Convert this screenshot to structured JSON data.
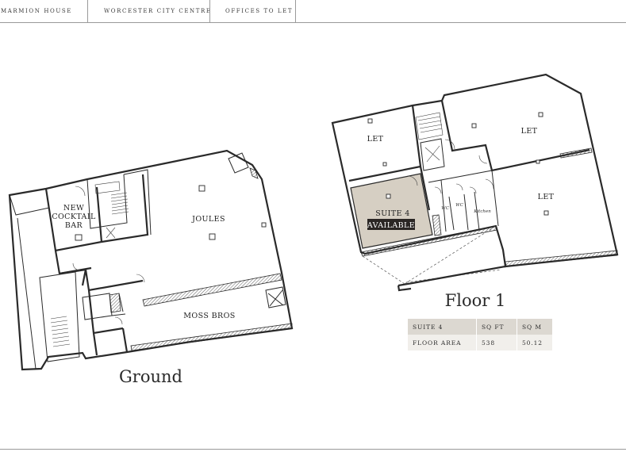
{
  "header": {
    "nav": [
      "MARMION HOUSE",
      "WORCESTER CITY CENTRE",
      "OFFICES TO LET"
    ]
  },
  "ground_plan": {
    "title": "Ground",
    "rooms": {
      "cocktail_bar": [
        "NEW",
        "COCKTAIL",
        "BAR"
      ],
      "joules": "JOULES",
      "moss_bros": "MOSS BROS"
    }
  },
  "floor1_plan": {
    "title": "Floor 1",
    "rooms": {
      "let_1": "LET",
      "let_2": "LET",
      "let_3": "LET",
      "suite": "SUITE 4",
      "status": "AVAILABLE",
      "wc_1": "WC",
      "wc_2": "WC",
      "kitchen": "Kitchen"
    },
    "colors": {
      "highlight_fill": "#d6cfc3",
      "badge_bg": "#2a2624"
    }
  },
  "area_table": {
    "headers": [
      "SUITE 4",
      "SQ FT",
      "SQ M"
    ],
    "rows": [
      [
        "FLOOR AREA",
        "538",
        "50.12"
      ]
    ]
  }
}
